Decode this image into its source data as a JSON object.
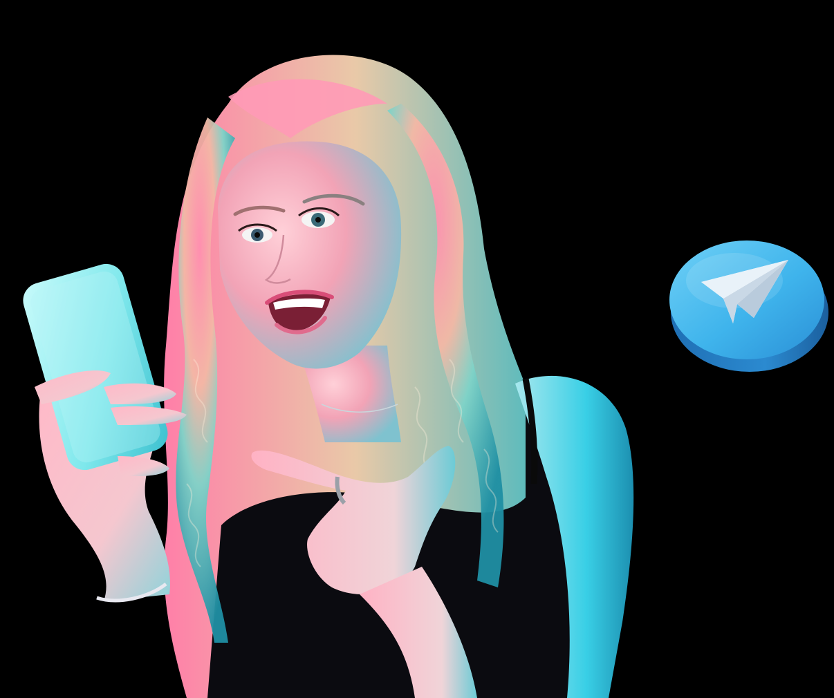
{
  "scene": {
    "background_color": "#000000",
    "subject": "person",
    "held_object": "phone",
    "gesture": "pointing-hand"
  },
  "telegram_badge": {
    "icon": "paper-plane-icon",
    "face_color": "#3fb4ec",
    "rim_color": "#1b73b8",
    "plane_color": "#ffffff"
  },
  "lighting": {
    "pink": "#ff6fa0",
    "cyan": "#37d6e8",
    "teal": "#2aa9b8"
  }
}
